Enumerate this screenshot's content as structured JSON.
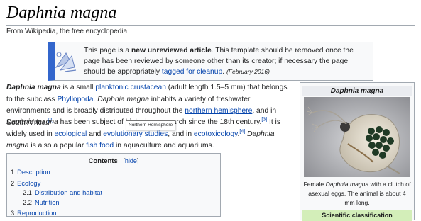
{
  "page": {
    "title": "Daphnia magna",
    "tagline": "From Wikipedia, the free encyclopedia"
  },
  "notice": {
    "t1": "This page is a ",
    "bold": "new unreviewed article",
    "t2": ". This template should be removed once the page has been reviewed by someone other than its creator; if necessary the page should be appropriately ",
    "link": "tagged for cleanup",
    "t3": ". ",
    "date": "(February 2016)"
  },
  "intro": {
    "name": "Daphnia magna",
    "t1": " is a small ",
    "link1": "planktonic",
    "t2": " ",
    "link2": "crustacean",
    "t3": " (adult length 1.5–5 mm) that belongs to the subclass ",
    "link3": "Phyllopoda",
    "t4": ". ",
    "name2": "Daphnia magna",
    "t5": " inhabits a variety of freshwater environments and is broadly distributed throughout the ",
    "link4": "northern hemisphere",
    "t6": ", and in South Africa.",
    "ref": "[2]"
  },
  "second": {
    "name": "Daphnia magna",
    "t1": " has been subject of bio",
    "hidden": "logical research",
    "t2": " since the 18th century.",
    "ref1": "[3]",
    "t3": " It is widely used in ",
    "link1": "ecological",
    "t4": " and ",
    "link2": "evolutionary studies",
    "t5": ", and in ",
    "link3": "ecotoxicology",
    "t6": ".",
    "ref2": "[4]",
    "t7": " ",
    "name2": "Daphnia magna",
    "t8": " is also a popular ",
    "link4": "fish food",
    "t9": " in aquaculture and aquariums."
  },
  "tooltip": "Northern Hemisphere",
  "toc": {
    "title": "Contents",
    "hide": "hide",
    "items": [
      {
        "num": "1",
        "label": "Description"
      },
      {
        "num": "2",
        "label": "Ecology"
      },
      {
        "num": "2.1",
        "label": "Distribution and habitat"
      },
      {
        "num": "2.2",
        "label": "Nutrition"
      },
      {
        "num": "3",
        "label": "Reproduction"
      }
    ]
  },
  "infobox": {
    "title": "Daphnia magna",
    "caption_pre": "Female ",
    "caption_name": "Daphnia magna",
    "caption_post": " with a clutch of asexual eggs. The animal is about 4 mm long.",
    "section": "Scientific classification"
  },
  "colors": {
    "link": "#0645ad",
    "notice_bar": "#3366cc",
    "infobox_header": "#eaecf0",
    "classification": "#d3eeb9"
  },
  "icons": {
    "notice": "new-article-icon"
  }
}
